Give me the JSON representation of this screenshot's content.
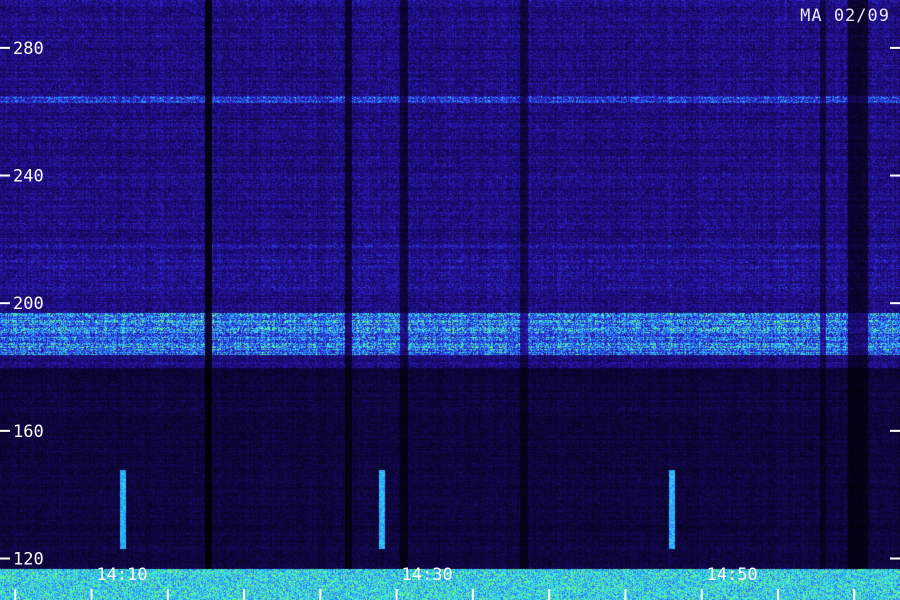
{
  "corner_label": "MA 02/09",
  "chart_data": {
    "type": "heatmap",
    "title": "",
    "xlabel": "",
    "ylabel": "",
    "ylim": [
      107,
      295
    ],
    "xlim": [
      "14:02",
      "14:61"
    ],
    "y_ticks": [
      "280",
      "240",
      "200",
      "160",
      "120"
    ],
    "y_tick_values": [
      280,
      240,
      200,
      160,
      120
    ],
    "x_ticks": [
      "14:10",
      "14:30",
      "14:50"
    ],
    "x_tick_minutes": [
      10,
      30,
      50
    ],
    "bands": [
      {
        "y_from": 184,
        "y_to": 197,
        "intensity": 0.75
      },
      {
        "y_from": 203,
        "y_to": 219,
        "intensity": 0.35
      },
      {
        "y_from": 263,
        "y_to": 265,
        "intensity": 0.55
      }
    ],
    "bursts_minutes": [
      10,
      27,
      46
    ],
    "grid": false,
    "legend": "none",
    "colormap": [
      "#000000",
      "#1a0a6e",
      "#2e1fcf",
      "#2a7cff",
      "#32e6f2",
      "#7cff5a"
    ]
  }
}
